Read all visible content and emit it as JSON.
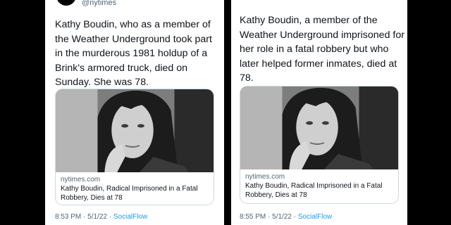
{
  "left_tweet": {
    "handle": "@nytimes",
    "text": "Kathy Boudin, who as a member of the Weather Underground took part in the murderous 1981 holdup of a Brink's armored truck, died on Sunday. She was 78.",
    "card": {
      "domain": "nytimes.com",
      "title": "Kathy Boudin, Radical Imprisoned in a Fatal Robbery, Dies at 78"
    },
    "time": "8:53 PM",
    "separator": "·",
    "date": "5/1/22",
    "source": "SocialFlow"
  },
  "right_tweet": {
    "text": "Kathy Boudin, a member of the Weather Underground imprisoned for her role in a fatal robbery but who later helped former inmates, died at 78.",
    "card": {
      "domain": "nytimes.com",
      "title": "Kathy Boudin, Radical Imprisoned in a Fatal Robbery, Dies at 78"
    },
    "time": "8:55 PM",
    "separator": "·",
    "date": "5/1/22",
    "source": "SocialFlow"
  },
  "colors": {
    "background": "#000000",
    "card_bg": "#ffffff",
    "text": "#0f1419",
    "secondary": "#536471",
    "link": "#1d9bf0",
    "border": "#cfd9de"
  }
}
